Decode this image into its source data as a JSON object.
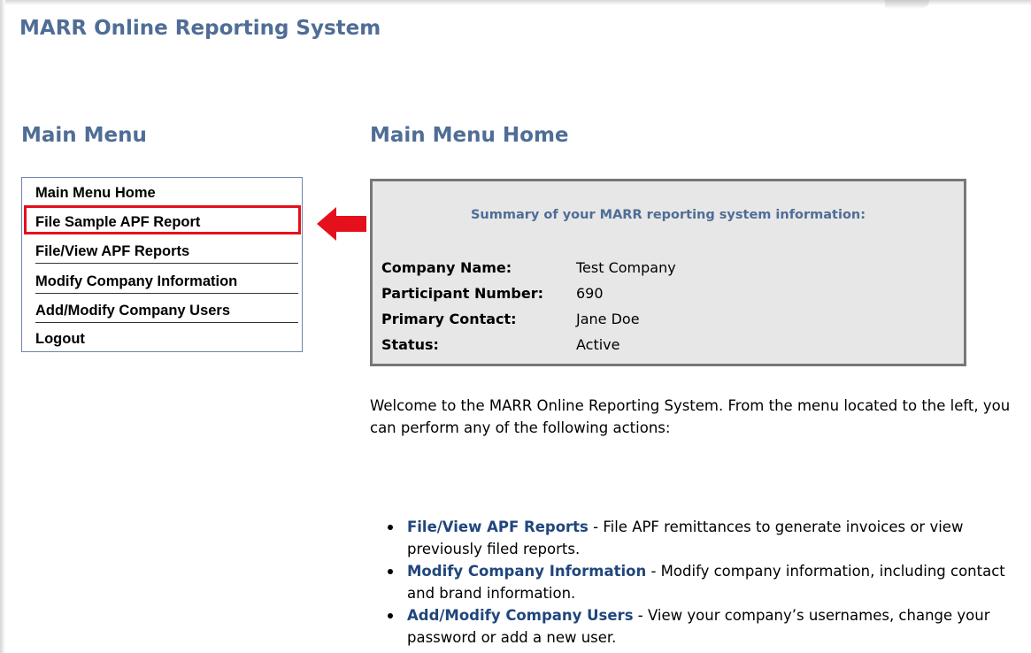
{
  "app": {
    "title": "MARR Online Reporting System"
  },
  "menu": {
    "heading": "Main Menu",
    "items": [
      {
        "label": "Main Menu Home"
      },
      {
        "label": "File Sample APF Report"
      },
      {
        "label": "File/View APF Reports"
      },
      {
        "label": "Modify Company Information"
      },
      {
        "label": "Add/Modify Company Users"
      },
      {
        "label": "Logout"
      }
    ],
    "highlight_color": "#e4101b"
  },
  "main": {
    "heading": "Main Menu Home",
    "summary": {
      "title": "Summary of your MARR reporting system information:",
      "rows": [
        {
          "label": "Company Name:",
          "value": "Test Company"
        },
        {
          "label": "Participant Number:",
          "value": "690"
        },
        {
          "label": "Primary Contact:",
          "value": "Jane Doe"
        },
        {
          "label": "Status:",
          "value": "Active"
        }
      ]
    },
    "intro": "Welcome to the MARR Online Reporting System. From the menu located to the left, you can perform any of the following actions:",
    "actions": [
      {
        "link": "File/View APF Reports",
        "desc": " - File APF remittances to generate invoices or view previously filed reports."
      },
      {
        "link": "Modify Company Information",
        "desc": " - Modify company information, including contact and brand information."
      },
      {
        "link": "Add/Modify Company Users",
        "desc": " - View your company’s usernames, change your password or add a new user."
      }
    ]
  },
  "icons": {
    "pointer": "red-arrow-left-icon",
    "bullet": "bullet-icon"
  },
  "colors": {
    "heading": "#4f6d96",
    "link": "#20467c",
    "summary_bg": "#e7e7e7"
  }
}
